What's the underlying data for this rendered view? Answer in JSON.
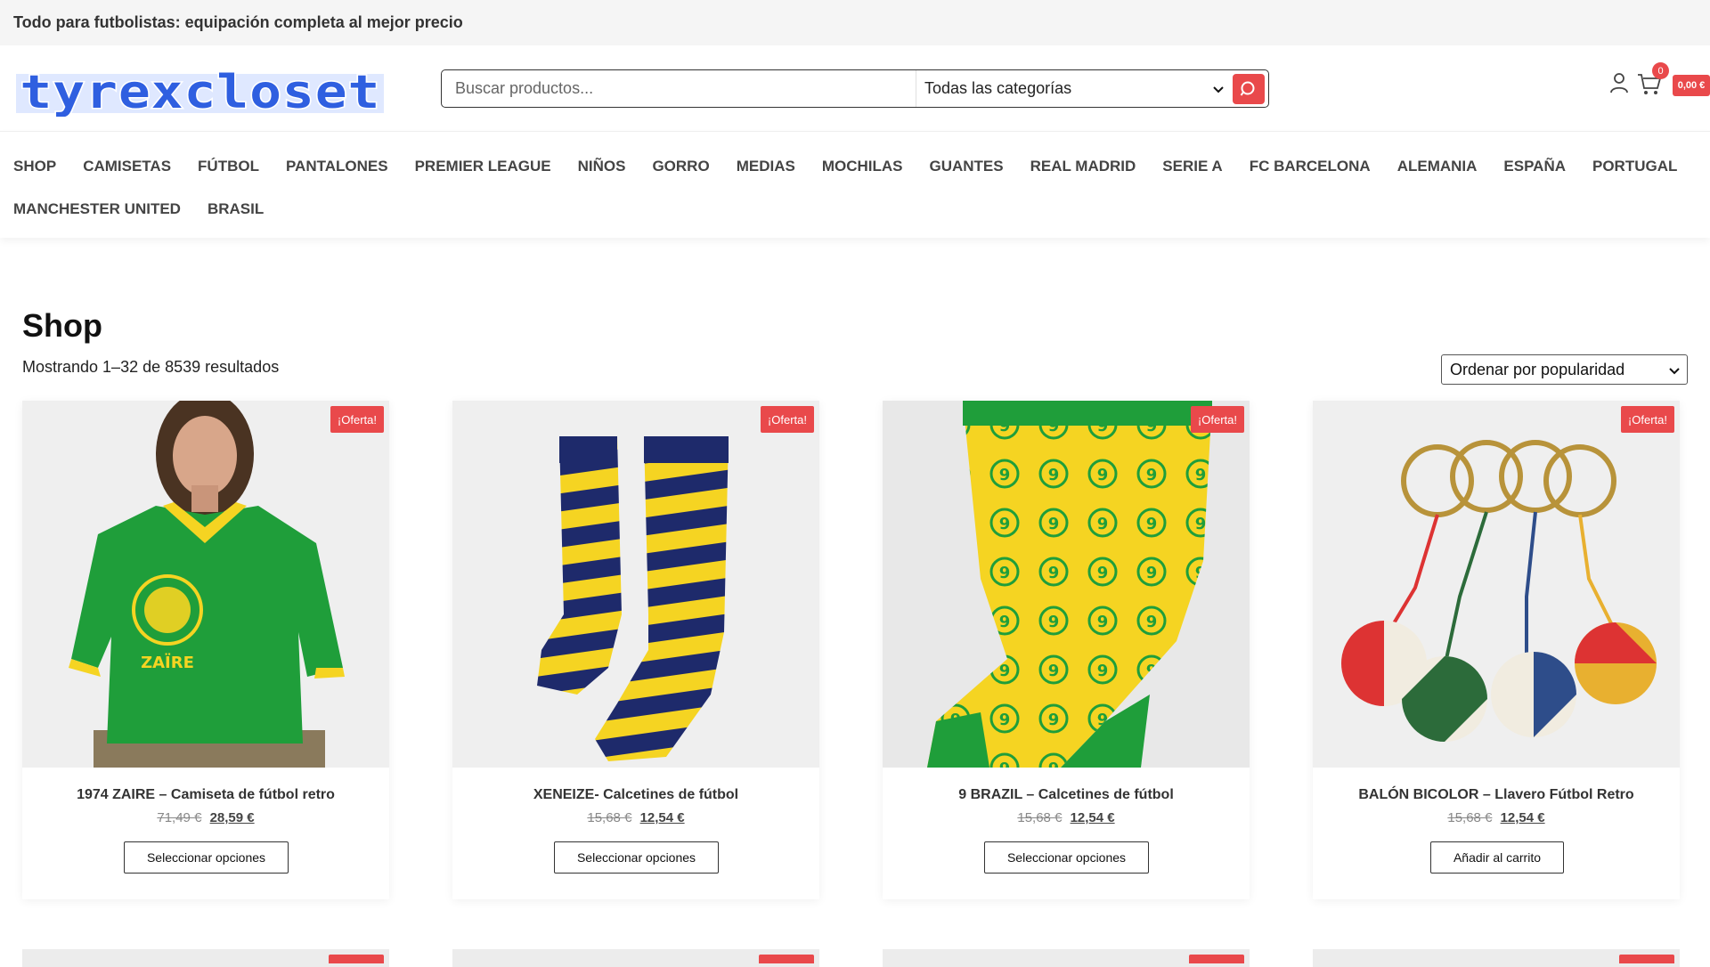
{
  "topbar": {
    "text": "Todo para futbolistas: equipación completa al mejor precio"
  },
  "header": {
    "logo_text": "tyrexcloset",
    "search_placeholder": "Buscar productos...",
    "search_category": "Todas las categorías",
    "cart_count": "0",
    "cart_total": "0,00 €"
  },
  "nav": {
    "items": [
      "SHOP",
      "CAMISETAS",
      "FÚTBOL",
      "PANTALONES",
      "PREMIER LEAGUE",
      "NIÑOS",
      "GORRO",
      "MEDIAS",
      "MOCHILAS",
      "GUANTES",
      "REAL MADRID",
      "SERIE A",
      "FC BARCELONA",
      "ALEMANIA",
      "ESPAÑA",
      "PORTUGAL",
      "MANCHESTER UNITED",
      "BRASIL"
    ]
  },
  "shop": {
    "title": "Shop",
    "result_count": "Mostrando 1–32 de 8539 resultados",
    "sort_selected": "Ordenar por popularidad"
  },
  "products": [
    {
      "name": "1974 ZAIRE – Camiseta de fútbol retro",
      "old_price": "71,49 €",
      "new_price": "28,59 €",
      "badge": "¡Oferta!",
      "button": "Seleccionar opciones"
    },
    {
      "name": "XENEIZE- Calcetines de fútbol",
      "old_price": "15,68 €",
      "new_price": "12,54 €",
      "badge": "¡Oferta!",
      "button": "Seleccionar opciones"
    },
    {
      "name": "9 BRAZIL – Calcetines de fútbol",
      "old_price": "15,68 €",
      "new_price": "12,54 €",
      "badge": "¡Oferta!",
      "button": "Seleccionar opciones"
    },
    {
      "name": "BALÓN BICOLOR – Llavero Fútbol Retro",
      "old_price": "15,68 €",
      "new_price": "12,54 €",
      "badge": "¡Oferta!",
      "button": "Añadir al carrito"
    }
  ],
  "colors": {
    "accent": "#e9494b",
    "logo_blue": "#2f5fe0",
    "shirt_green": "#1f9e3a",
    "sock_navy": "#1e2a6b",
    "sock_yellow": "#f5d422"
  }
}
